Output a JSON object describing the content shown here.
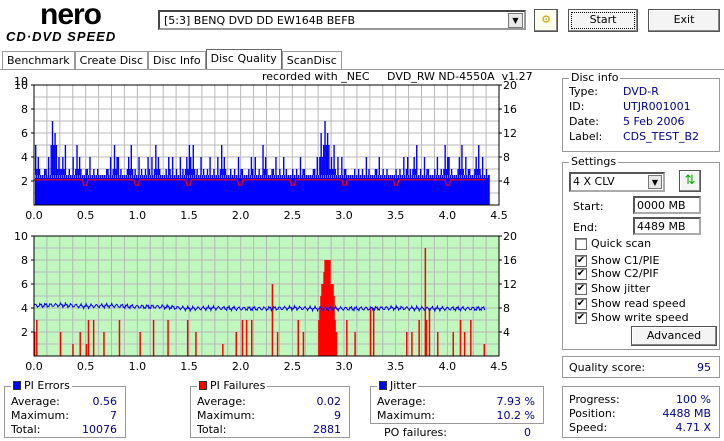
{
  "app": {
    "logo_top": "nero",
    "logo_bottom": "CD·DVD SPEED"
  },
  "toolbar": {
    "drive": "[5:3]  BENQ DVD DD EW164B BEFB",
    "start_label": "Start",
    "exit_label": "Exit"
  },
  "tabs": [
    {
      "label": "Benchmark"
    },
    {
      "label": "Create Disc"
    },
    {
      "label": "Disc Info"
    },
    {
      "label": "Disc Quality",
      "active": true
    },
    {
      "label": "ScanDisc"
    }
  ],
  "recorded_with": "recorded with _NEC     DVD_RW ND-4550A  v1.27",
  "disc_info": {
    "title": "Disc info",
    "type_label": "Type:",
    "type": "DVD-R",
    "id_label": "ID:",
    "id": "UTJR001001",
    "date_label": "Date:",
    "date": "5 Feb 2006",
    "label_label": "Label:",
    "label": "CDS_TEST_B2"
  },
  "settings": {
    "title": "Settings",
    "speed": "4 X CLV",
    "start_label": "Start:",
    "start": "0000 MB",
    "end_label": "End:",
    "end": "4489 MB",
    "checks": [
      {
        "label": "Quick scan",
        "checked": false
      },
      {
        "label": "Show C1/PIE",
        "checked": true
      },
      {
        "label": "Show C2/PIF",
        "checked": true
      },
      {
        "label": "Show jitter",
        "checked": true
      },
      {
        "label": "Show read speed",
        "checked": true
      },
      {
        "label": "Show write speed",
        "checked": true
      }
    ],
    "advanced_label": "Advanced"
  },
  "quality": {
    "label": "Quality score:",
    "value": "95"
  },
  "pi_errors": {
    "title": "PI Errors",
    "avg_label": "Average:",
    "avg": "0.56",
    "max_label": "Maximum:",
    "max": "7",
    "total_label": "Total:",
    "total": "10076"
  },
  "pi_failures": {
    "title": "PI Failures",
    "avg_label": "Average:",
    "avg": "0.02",
    "max_label": "Maximum:",
    "max": "9",
    "total_label": "Total:",
    "total": "2881"
  },
  "jitter": {
    "title": "Jitter",
    "avg_label": "Average:",
    "avg": "7.93 %",
    "max_label": "Maximum:",
    "max": "10.2 %",
    "po_label": "PO failures:",
    "po": "0"
  },
  "progress": {
    "progress_label": "Progress:",
    "progress": "100 %",
    "position_label": "Position:",
    "position": "4488 MB",
    "speed_label": "Speed:",
    "speed": "4.71 X"
  },
  "colors": {
    "pie": "#0000ff",
    "pif": "#ff0000",
    "jitter": "#0000ff",
    "read_speed": "#ff0000",
    "bottom_bg": "#c0f8c0"
  },
  "chart_data": [
    {
      "type": "bar",
      "title": "PI Errors",
      "xlim": [
        0,
        4.5
      ],
      "ylim": [
        0,
        10
      ],
      "ylim_right": [
        0,
        20
      ],
      "xticks": [
        "0.0",
        "0.5",
        "1.0",
        "1.5",
        "2.0",
        "2.5",
        "3.0",
        "3.5",
        "4.0",
        "4.5"
      ],
      "yticks": [
        "2",
        "4",
        "6",
        "8",
        "10"
      ],
      "yticks_right": [
        "4",
        "8",
        "12",
        "16",
        "20"
      ],
      "x_step": 0.05,
      "baseline": 2.5,
      "pie_max": [
        5,
        3,
        4,
        7,
        5,
        5,
        3,
        4,
        5,
        3,
        4,
        3,
        3,
        3,
        4,
        5,
        4,
        3,
        5,
        3,
        4,
        4,
        4,
        5,
        3,
        4,
        4,
        3,
        4,
        5,
        5,
        3,
        4,
        4,
        3,
        4,
        5,
        3,
        3,
        4,
        3,
        4,
        4,
        3,
        5,
        3,
        4,
        3,
        4,
        3,
        3,
        4,
        3,
        3,
        4,
        6,
        7,
        5,
        4,
        4,
        3,
        3,
        3,
        3,
        4,
        3,
        4,
        3,
        3,
        3,
        3,
        4,
        4,
        5,
        3,
        4,
        3,
        4,
        3,
        5,
        4,
        3,
        5,
        4,
        3,
        5,
        4,
        3
      ],
      "read_speed": {
        "name": "read speed (X, right axis)",
        "level": 4.2,
        "dips_at": [
          0.5,
          1.0,
          1.5,
          2.0,
          2.5,
          3.0,
          3.5,
          4.0
        ],
        "dip_value": 3.3,
        "end": 4.37
      }
    },
    {
      "type": "bar",
      "title": "PI Failures / Jitter",
      "xlim": [
        0,
        4.5
      ],
      "ylim": [
        0,
        10
      ],
      "ylim_right": [
        0,
        20
      ],
      "xticks": [
        "0.0",
        "0.5",
        "1.0",
        "1.5",
        "2.0",
        "2.5",
        "3.0",
        "3.5",
        "4.0",
        "4.5"
      ],
      "yticks": [
        "2",
        "4",
        "6",
        "8",
        "10"
      ],
      "yticks_right": [
        "4",
        "8",
        "12",
        "16",
        "20"
      ],
      "pif": [
        [
          0.0,
          2
        ],
        [
          0.02,
          3
        ],
        [
          0.25,
          2
        ],
        [
          0.37,
          1
        ],
        [
          0.44,
          2
        ],
        [
          0.5,
          1
        ],
        [
          0.52,
          3
        ],
        [
          0.57,
          3
        ],
        [
          0.67,
          2
        ],
        [
          0.82,
          3
        ],
        [
          1.02,
          2
        ],
        [
          1.15,
          3
        ],
        [
          1.29,
          3
        ],
        [
          1.48,
          3
        ],
        [
          1.56,
          2
        ],
        [
          1.82,
          1
        ],
        [
          1.95,
          2
        ],
        [
          2.01,
          3
        ],
        [
          2.05,
          3
        ],
        [
          2.1,
          3
        ],
        [
          2.3,
          6
        ],
        [
          2.35,
          2
        ],
        [
          2.55,
          3
        ],
        [
          2.6,
          2
        ],
        [
          2.75,
          3
        ],
        [
          2.76,
          4
        ],
        [
          2.77,
          5
        ],
        [
          2.78,
          6
        ],
        [
          2.79,
          6
        ],
        [
          2.8,
          7
        ],
        [
          2.81,
          8
        ],
        [
          2.82,
          7
        ],
        [
          2.83,
          6
        ],
        [
          2.84,
          8
        ],
        [
          2.85,
          6
        ],
        [
          2.86,
          6
        ],
        [
          2.87,
          6
        ],
        [
          2.88,
          5
        ],
        [
          2.89,
          3
        ],
        [
          2.9,
          2
        ],
        [
          2.92,
          2
        ],
        [
          3.02,
          3
        ],
        [
          3.1,
          2
        ],
        [
          3.25,
          4
        ],
        [
          3.28,
          4
        ],
        [
          3.6,
          2
        ],
        [
          3.65,
          2
        ],
        [
          3.72,
          3
        ],
        [
          3.78,
          9
        ],
        [
          3.79,
          3
        ],
        [
          3.82,
          4
        ],
        [
          3.9,
          2
        ],
        [
          4.05,
          2
        ],
        [
          4.12,
          3
        ],
        [
          4.16,
          2
        ],
        [
          4.22,
          3
        ],
        [
          4.35,
          1
        ]
      ],
      "jitter_step": 0.25,
      "jitter": [
        8.4,
        8.5,
        8.3,
        8.4,
        8.2,
        8.2,
        7.9,
        8.0,
        7.9,
        7.9,
        8.0,
        7.9,
        7.9,
        7.9,
        8.0,
        7.9,
        7.9,
        7.9
      ]
    }
  ]
}
